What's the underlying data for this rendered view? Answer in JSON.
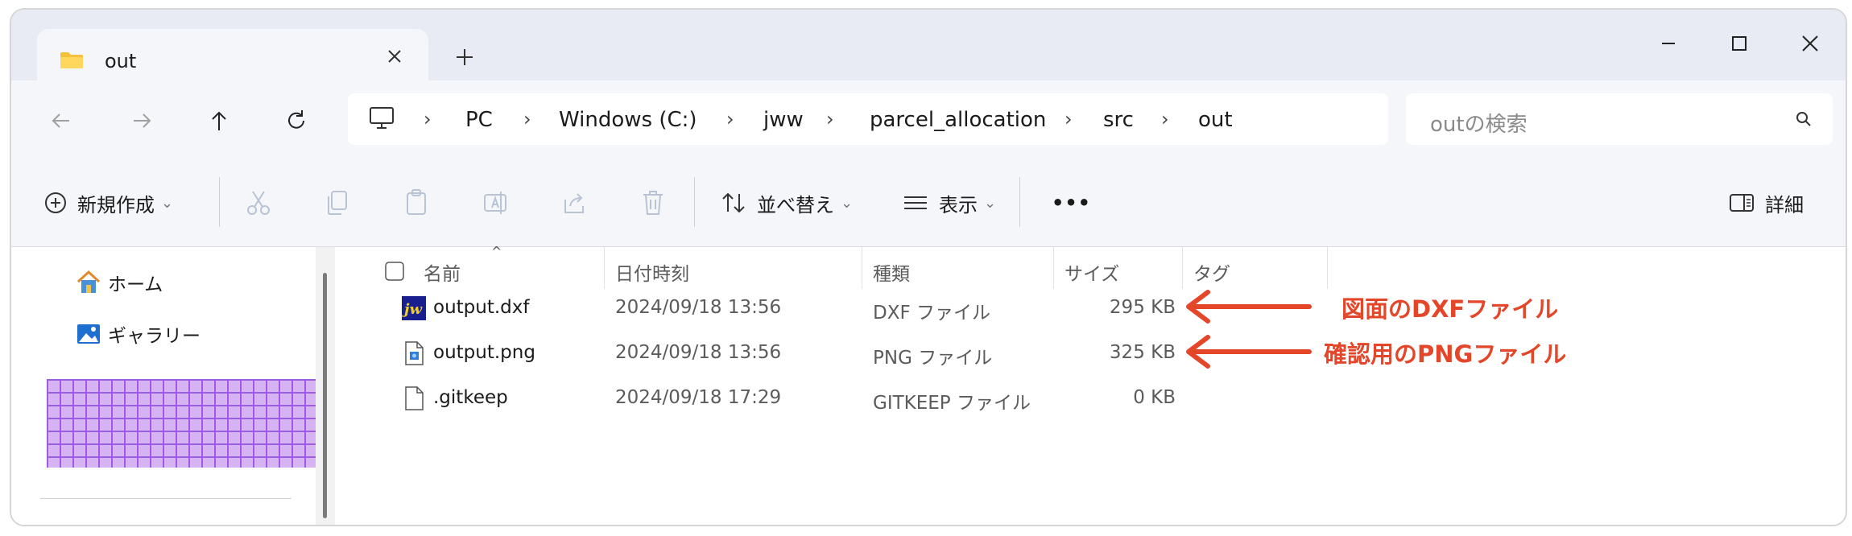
{
  "tab": {
    "title": "out"
  },
  "window_controls": {
    "minimize": "—",
    "maximize": "☐",
    "close": "✕"
  },
  "breadcrumb": [
    "PC",
    "Windows (C:)",
    "jww",
    "parcel_allocation",
    "src",
    "out"
  ],
  "search": {
    "placeholder": "outの検索"
  },
  "toolbar": {
    "new_label": "新規作成",
    "sort_label": "並べ替え",
    "view_label": "表示",
    "more_label": "•••",
    "details_label": "詳細"
  },
  "sidebar": {
    "items": [
      {
        "label": "ホーム",
        "icon": "home-icon"
      },
      {
        "label": "ギャラリー",
        "icon": "gallery-icon"
      }
    ]
  },
  "columns": [
    "名前",
    "日付時刻",
    "種類",
    "サイズ",
    "タグ"
  ],
  "files": [
    {
      "name": "output.dxf",
      "date": "2024/09/18 13:56",
      "type": "DXF ファイル",
      "size": "295 KB",
      "icon": "jww-file-icon"
    },
    {
      "name": "output.png",
      "date": "2024/09/18 13:56",
      "type": "PNG ファイル",
      "size": "325 KB",
      "icon": "image-file-icon"
    },
    {
      "name": ".gitkeep",
      "date": "2024/09/18 17:29",
      "type": "GITKEEP ファイル",
      "size": "0 KB",
      "icon": "generic-file-icon"
    }
  ],
  "annotations": [
    {
      "text": "図面のDXFファイル"
    },
    {
      "text": "確認用のPNGファイル"
    }
  ],
  "colors": {
    "accent": "#e4462a",
    "titlebar": "#e8ebf3",
    "toolbar": "#f4f6fa",
    "redacted": "#b070f0"
  }
}
